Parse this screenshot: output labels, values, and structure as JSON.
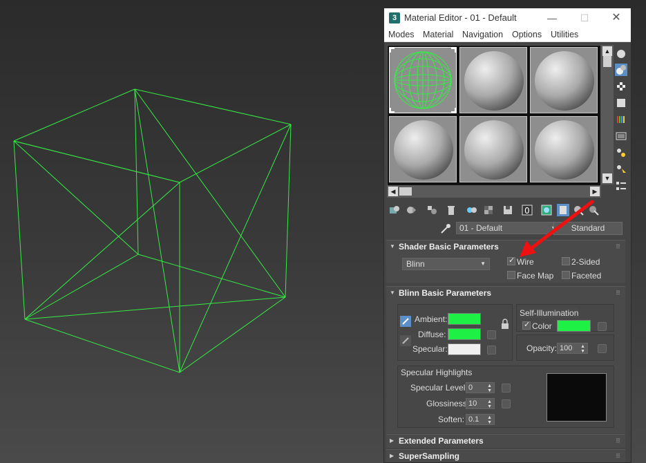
{
  "colors": {
    "wire": "#33ee44",
    "ambient": "#1ef046",
    "diffuse": "#1ef046",
    "specular": "#f0f0f0",
    "self_illum": "#1ef046",
    "arrow": "#ee1111"
  },
  "window": {
    "title": "Material Editor - 01 - Default",
    "app_icon": "3",
    "menu": [
      "Modes",
      "Material",
      "Navigation",
      "Options",
      "Utilities"
    ]
  },
  "name_row": {
    "material_name": "01 - Default",
    "type_button": "Standard"
  },
  "shader_basic": {
    "header": "Shader Basic Parameters",
    "shader": "Blinn",
    "wire": {
      "label": "Wire",
      "checked": true
    },
    "two_sided": {
      "label": "2-Sided",
      "checked": false
    },
    "face_map": {
      "label": "Face Map",
      "checked": false
    },
    "faceted": {
      "label": "Faceted",
      "checked": false
    }
  },
  "blinn_basic": {
    "header": "Blinn Basic Parameters",
    "ambient_label": "Ambient:",
    "diffuse_label": "Diffuse:",
    "specular_label": "Specular:",
    "self_illum": {
      "group": "Self-Illumination",
      "color_label": "Color",
      "checked": true
    },
    "opacity": {
      "label": "Opacity:",
      "value": "100"
    },
    "spec_highlights": {
      "group": "Specular Highlights",
      "level": {
        "label": "Specular Level:",
        "value": "0"
      },
      "glossiness": {
        "label": "Glossiness:",
        "value": "10"
      },
      "soften": {
        "label": "Soften:",
        "value": "0.1"
      }
    }
  },
  "extended": {
    "header": "Extended Parameters"
  },
  "supersampling": {
    "header": "SuperSampling"
  }
}
